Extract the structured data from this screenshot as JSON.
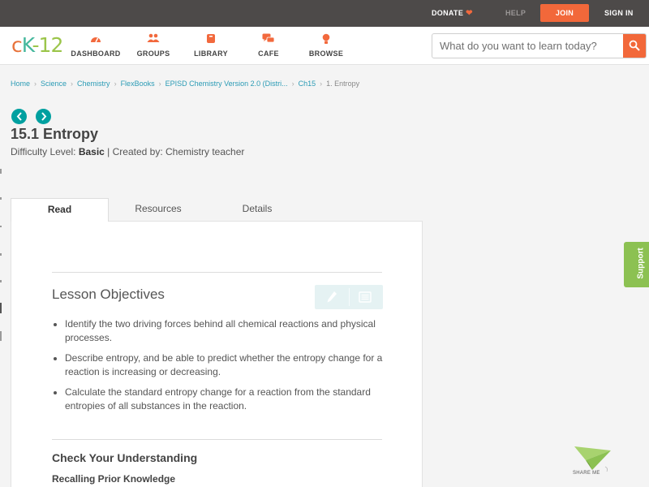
{
  "topbar": {
    "donate": "DONATE",
    "help": "HELP",
    "join": "JOIN",
    "sign_in": "SIGN IN"
  },
  "logo": {
    "c": "c",
    "k": "K",
    "n": "-12"
  },
  "nav": {
    "dashboard": "DASHBOARD",
    "groups": "GROUPS",
    "library": "LIBRARY",
    "cafe": "CAFE",
    "browse": "BROWSE"
  },
  "search": {
    "placeholder": "What do you want to learn today?"
  },
  "breadcrumb": [
    "Home",
    "Science",
    "Chemistry",
    "FlexBooks",
    "EPISD Chemistry Version 2.0 (Distri...",
    "Ch15",
    "1. Entropy"
  ],
  "page": {
    "title": "15.1 Entropy",
    "difficulty_label": "Difficulty Level: ",
    "difficulty_value": "Basic",
    "created_by": " | Created by: Chemistry teacher"
  },
  "tabs": {
    "read": "Read",
    "resources": "Resources",
    "details": "Details"
  },
  "lesson": {
    "objectives_heading": "Lesson Objectives",
    "objectives": [
      "Identify the two driving forces behind all chemical reactions and physical processes.",
      "Describe entropy, and be able to predict whether the entropy change for a reaction is increasing or decreasing.",
      "Calculate the standard entropy change for a reaction from the standard entropies of all substances in the reaction."
    ],
    "check_heading": "Check Your Understanding",
    "recalling": "Recalling Prior Knowledge"
  },
  "support": "Support",
  "share": "SHARE ME",
  "colors": {
    "brand_orange": "#f2683a",
    "teal": "#00a0a0",
    "support_green": "#8cc152",
    "topbar": "#4d4a49"
  },
  "icons": [
    "heart-icon",
    "dashboard-icon",
    "groups-icon",
    "library-icon",
    "cafe-icon",
    "browse-icon",
    "search-icon",
    "chevron-left-icon",
    "chevron-right-icon",
    "pencil-icon",
    "notes-icon",
    "paper-plane-icon"
  ]
}
